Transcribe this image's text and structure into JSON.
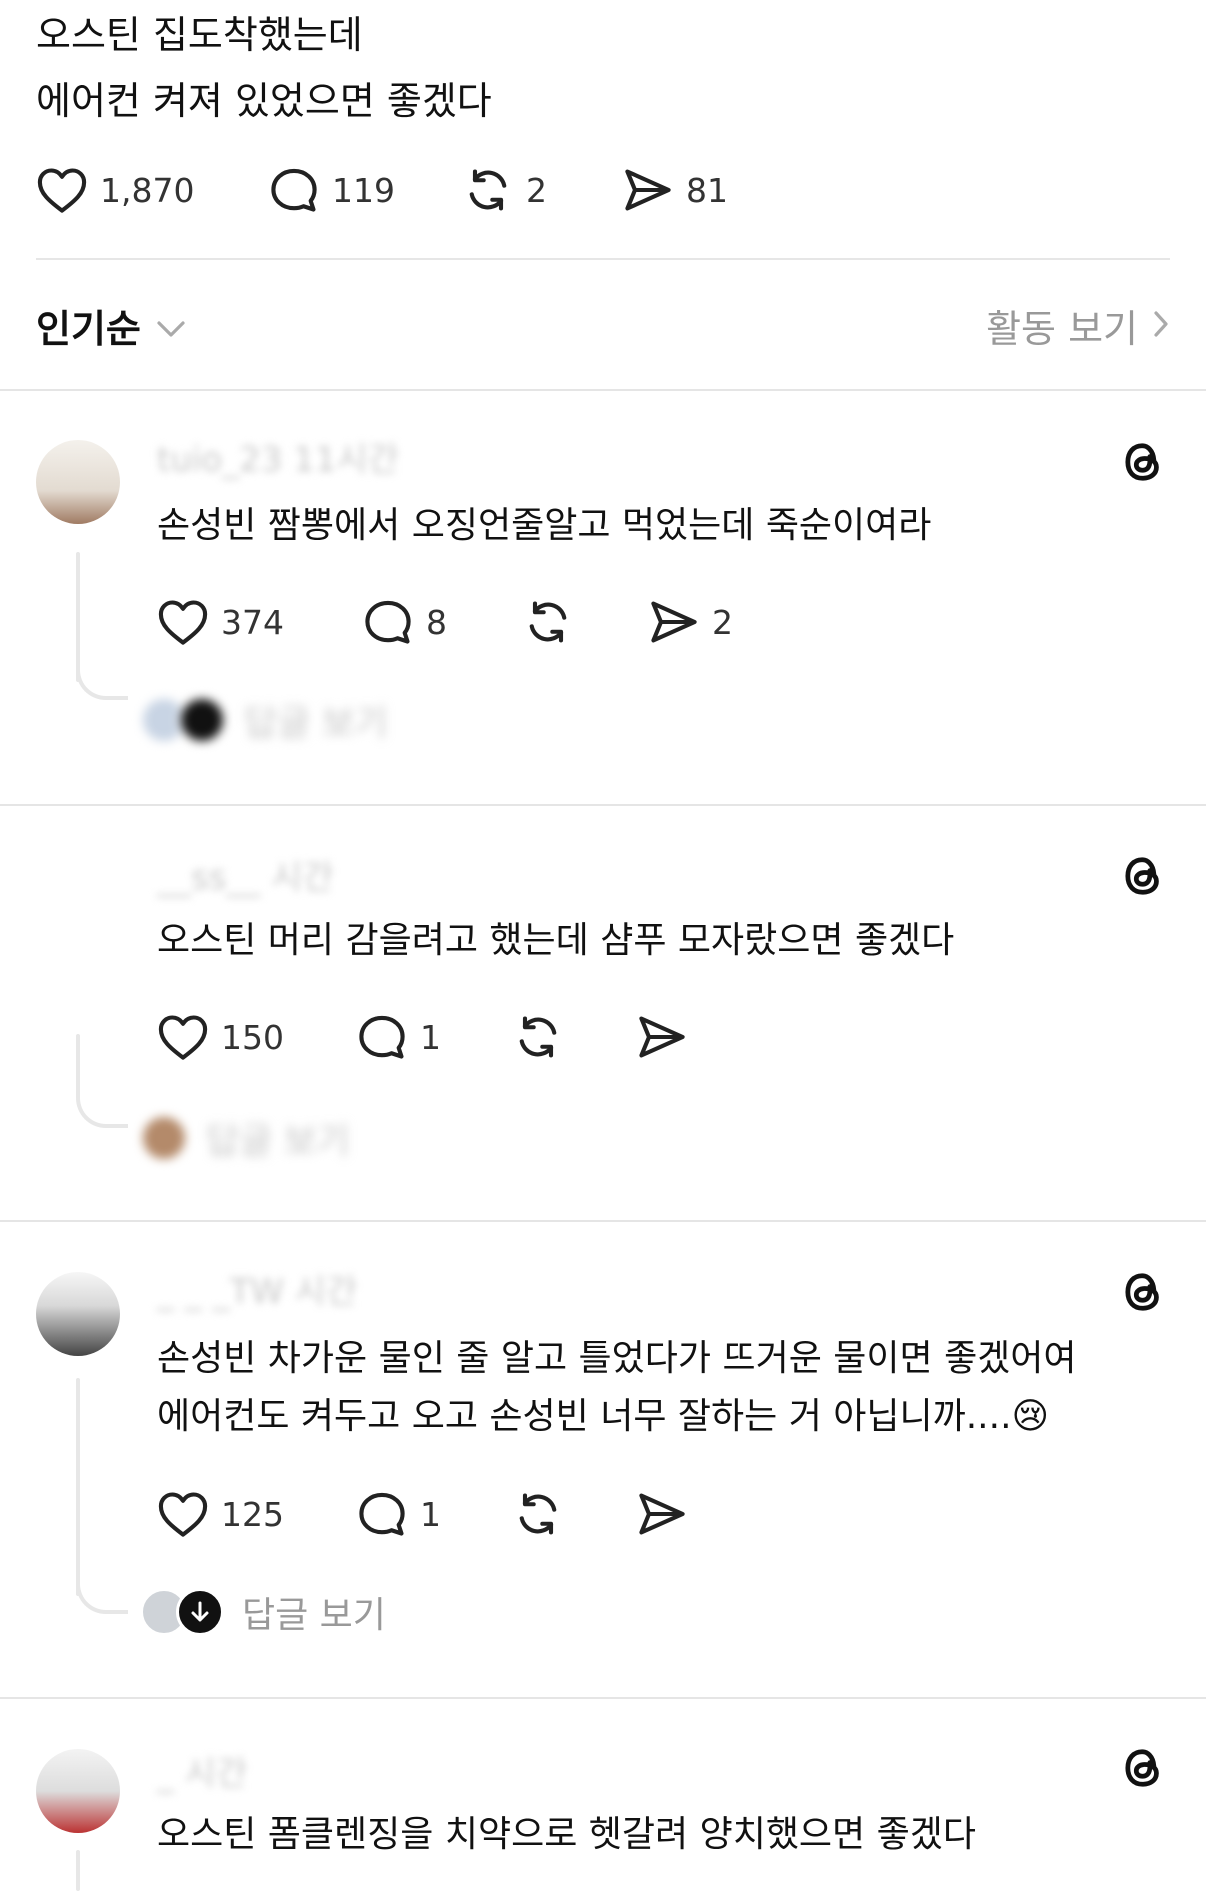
{
  "post": {
    "line1": "오스틴 집도착했는데",
    "line2": "에어컨 켜져 있었으면 좋겠다",
    "likes": "1,870",
    "comments": "119",
    "reposts": "2",
    "shares": "81"
  },
  "sort": {
    "label": "인기순",
    "activity_label": "활동 보기"
  },
  "replies": [
    {
      "username": "tuio_23 11시간",
      "text": "손성빈 짬뽕에서 오징언줄알고 먹었는데 죽순이여라",
      "likes": "374",
      "comments": "8",
      "reposts": "",
      "shares": "2",
      "view_replies": "답글 보기"
    },
    {
      "username": "__ss__ 시간",
      "text": "오스틴 머리 감을려고 했는데 샴푸 모자랐으면 좋겠다",
      "likes": "150",
      "comments": "1",
      "reposts": "",
      "shares": "",
      "view_replies": "답글 보기"
    },
    {
      "username": "_ _ _TW 시간",
      "text_line1": "손성빈 차가운 물인 줄 알고 틀었다가 뜨거운 물이면 좋겠어여",
      "text_line2": "에어컨도 켜두고 오고 손성빈 너무 잘하는 거 아닙니까....😢",
      "likes": "125",
      "comments": "1",
      "reposts": "",
      "shares": "",
      "view_replies": "답글 보기"
    },
    {
      "username": "_ 시간",
      "text": "오스틴 폼클렌징을 치약으로 헷갈려 양치했으면 좋겠다"
    }
  ],
  "icons": {
    "like": "heart-icon",
    "comment": "speech-bubble-icon",
    "repost": "repost-icon",
    "share": "send-icon",
    "threads": "threads-logo-icon",
    "sort_chevron": "chevron-down-icon",
    "activity_chevron": "chevron-right-icon"
  },
  "colors": {
    "text": "#111111",
    "muted": "#999999",
    "divider": "#e5e5e5"
  }
}
